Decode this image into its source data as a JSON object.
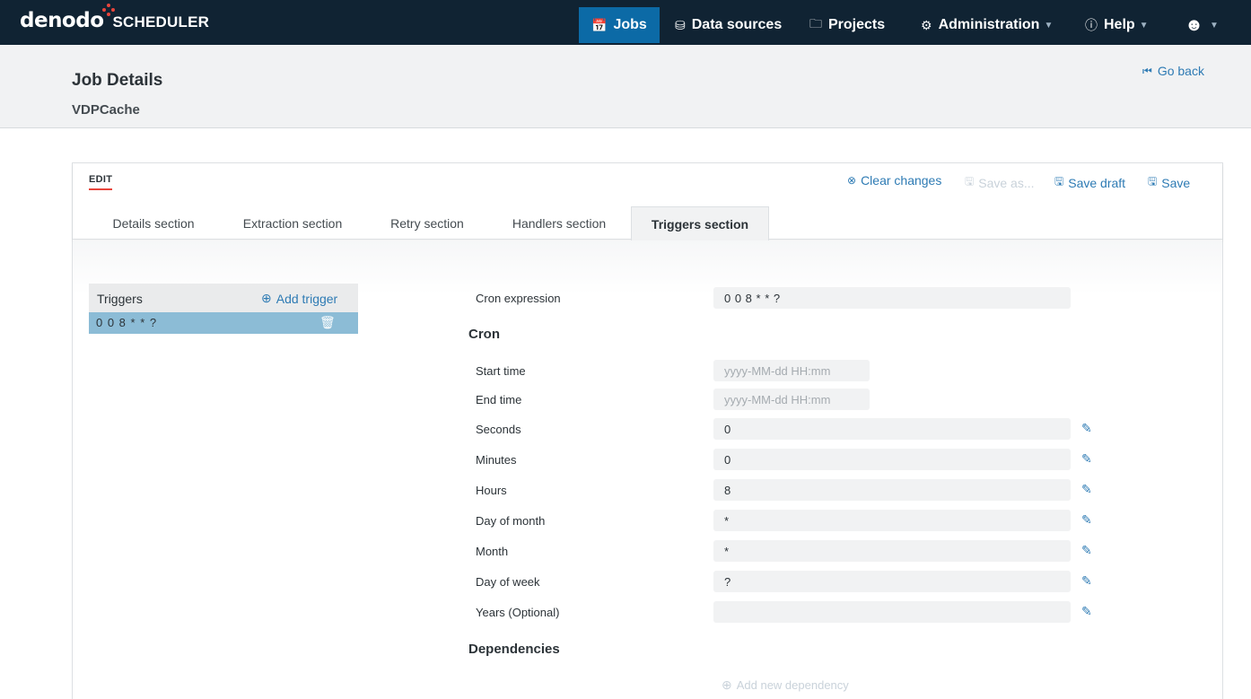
{
  "app": {
    "brand": "denodo",
    "product": "SCHEDULER"
  },
  "nav": {
    "jobs": "Jobs",
    "data_sources": "Data sources",
    "projects": "Projects",
    "administration": "Administration",
    "help": "Help"
  },
  "header": {
    "title": "Job Details",
    "job_name": "VDPCache",
    "go_back": "Go back"
  },
  "edit": {
    "label": "EDIT",
    "clear_changes": "Clear changes",
    "save_as": "Save as...",
    "save_draft": "Save draft",
    "save": "Save"
  },
  "tabs": [
    {
      "label": "Details section"
    },
    {
      "label": "Extraction section"
    },
    {
      "label": "Retry section"
    },
    {
      "label": "Handlers section"
    },
    {
      "label": "Triggers section",
      "active": true
    }
  ],
  "triggers": {
    "title": "Triggers",
    "add_label": "Add trigger",
    "items": [
      {
        "expression": "0 0 8 * * ?"
      }
    ]
  },
  "form": {
    "cron_expression": {
      "label": "Cron expression",
      "value": "0 0 8 * * ?"
    },
    "cron_heading": "Cron",
    "start_time": {
      "label": "Start time",
      "placeholder": "yyyy-MM-dd HH:mm"
    },
    "end_time": {
      "label": "End time",
      "placeholder": "yyyy-MM-dd HH:mm"
    },
    "seconds": {
      "label": "Seconds",
      "value": "0"
    },
    "minutes": {
      "label": "Minutes",
      "value": "0"
    },
    "hours": {
      "label": "Hours",
      "value": "8"
    },
    "day_of_month": {
      "label": "Day of month",
      "value": "*"
    },
    "month": {
      "label": "Month",
      "value": "*"
    },
    "day_of_week": {
      "label": "Day of week",
      "value": "?"
    },
    "years": {
      "label": "Years (Optional)",
      "value": ""
    },
    "dependencies_heading": "Dependencies",
    "add_dependency": "Add new dependency"
  },
  "colors": {
    "topbar": "#102333",
    "active_nav": "#0c6aa6",
    "accent": "#e8453c",
    "link": "#2e7bb4",
    "selected_row": "#8cbcd6"
  }
}
